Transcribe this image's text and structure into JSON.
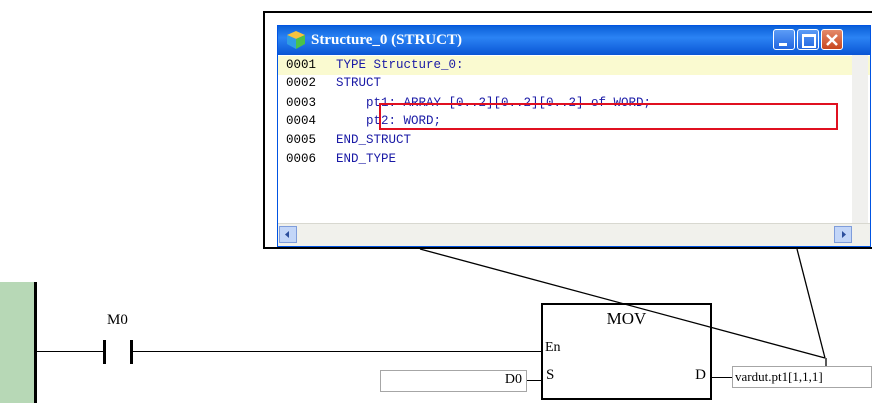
{
  "window": {
    "title": "Structure_0 (STRUCT)"
  },
  "code": [
    {
      "line": "0001",
      "text": "TYPE Structure_0:"
    },
    {
      "line": "0002",
      "text": "STRUCT"
    },
    {
      "line": "0003",
      "text": "    pt1: ARRAY [0..2][0..2][0..2] of WORD;"
    },
    {
      "line": "0004",
      "text": "    pt2: WORD;"
    },
    {
      "line": "0005",
      "text": "END_STRUCT"
    },
    {
      "line": "0006",
      "text": "END_TYPE"
    }
  ],
  "ladder": {
    "contact_label": "M0",
    "block_name": "MOV",
    "pin_en": "En",
    "pin_s": "S",
    "pin_d": "D",
    "input_s": "D0",
    "output_d": "vardut.pt1[1,1,1]"
  },
  "colors": {
    "keyword": "#1a1aa6",
    "highlight_box": "#e01020",
    "rail": "#b7d8b6",
    "titlebar": "#0a5fd8"
  }
}
